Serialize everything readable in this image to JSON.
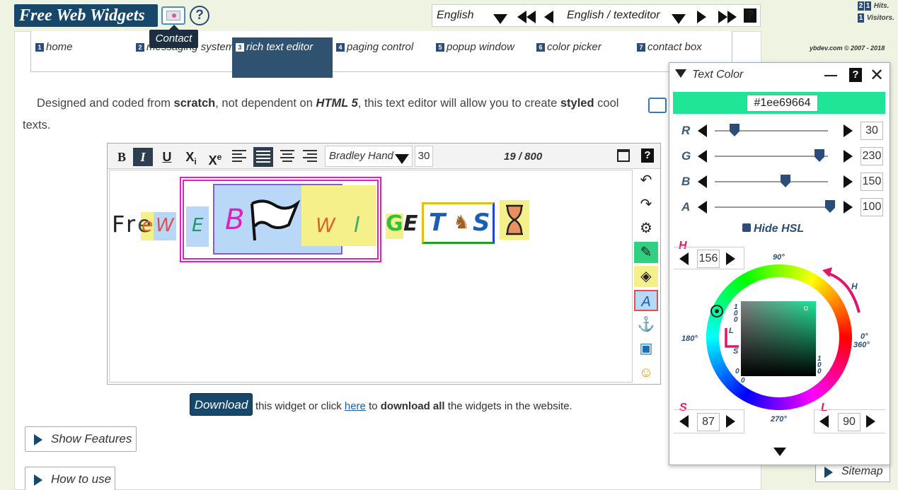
{
  "header": {
    "logo": "Free Web Widgets",
    "tooltip": "Contact",
    "help": "?",
    "lang_select": "English",
    "path_select": "English / texteditor",
    "help_box": "?"
  },
  "counters": {
    "hits_digits": [
      "2",
      "1"
    ],
    "hits_label": "Hits.",
    "visitors_digits": [
      "1"
    ],
    "visitors_label": "Visitors."
  },
  "copyright": "ybdev.com © 2007 - 2018",
  "nav": [
    {
      "num": "1",
      "label": "home"
    },
    {
      "num": "2",
      "label": "messaging system"
    },
    {
      "num": "3",
      "label": "rich text editor"
    },
    {
      "num": "4",
      "label": "paging control"
    },
    {
      "num": "5",
      "label": "popup window"
    },
    {
      "num": "6",
      "label": "color picker"
    },
    {
      "num": "7",
      "label": "contact box"
    }
  ],
  "description": {
    "p1": "Designed and coded from ",
    "b1": "scratch",
    "p2": ", not dependent on ",
    "b2": "HTML 5",
    "p3": ", this text editor will allow you to create ",
    "b3": "styled",
    "p4": " cool texts."
  },
  "editor": {
    "bold": "B",
    "italic": "I",
    "underline": "U",
    "subscript": "X",
    "subscript_sub": "i",
    "superscript": "X",
    "superscript_sup": "e",
    "font": "Bradley Hand ITC",
    "font_size": "30",
    "counter": "19 / 800",
    "help": "?",
    "content": {
      "F": "F",
      "r": "r",
      "e1": "e",
      "e2": "e",
      "w1": "W",
      "e3": "E",
      "B": "B",
      "w2": "W",
      "i": "I",
      "G": "G",
      "E": "E",
      "T": "T",
      "S": "S"
    }
  },
  "download": {
    "button": "Download",
    "t1": " this widget or click ",
    "link": "here",
    "t2": " to ",
    "bold": "download all",
    "t3": " the widgets in the website."
  },
  "accordions": {
    "features": "Show Features",
    "howto": "How to use"
  },
  "sitemap": "Sitemap",
  "color_panel": {
    "title": "Text Color",
    "help": "?",
    "hex": "#1ee69664",
    "swatch": "#1ee696",
    "rgba": [
      {
        "label": "R",
        "value": "30",
        "fraction": 0.118
      },
      {
        "label": "G",
        "value": "230",
        "fraction": 0.902
      },
      {
        "label": "B",
        "value": "150",
        "fraction": 0.588
      },
      {
        "label": "A",
        "value": "100",
        "fraction": 1.0
      }
    ],
    "hide_hsl": "Hide HSL",
    "h_label": "H",
    "h_value": "156",
    "s_label": "S",
    "s_value": "87",
    "l_label": "L",
    "l_value": "90",
    "deg_90": "90°",
    "deg_180": "180°",
    "deg_0": "0°",
    "deg_360": "360°",
    "deg_270": "270°",
    "ring_h": "H",
    "sq_l": "L",
    "sq_s": "S",
    "v100a": "100",
    "v0a": "0",
    "v100b": "100",
    "v0b": "0"
  }
}
